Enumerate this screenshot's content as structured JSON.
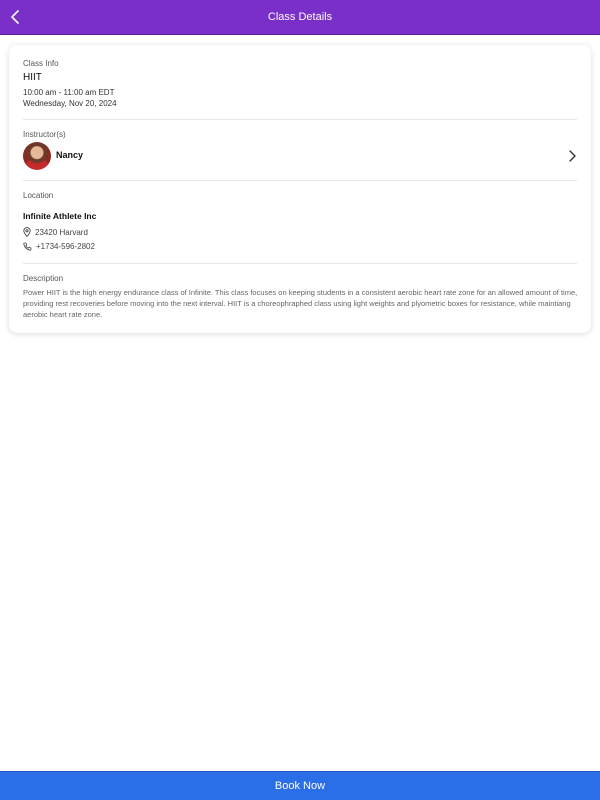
{
  "header": {
    "title": "Class Details",
    "back_icon": "chevron-left-icon",
    "color": "#7b2fc9"
  },
  "class_info": {
    "section_label": "Class Info",
    "name": "HIIT",
    "time": "10:00 am - 11:00 am EDT",
    "date": "Wednesday, Nov 20, 2024"
  },
  "instructors": {
    "section_label": "Instructor(s)",
    "items": [
      {
        "name": "Nancy"
      }
    ]
  },
  "location": {
    "section_label": "Location",
    "name": "Infinite Athlete Inc",
    "address": "23420 Harvard",
    "phone": "+1734-596-2802"
  },
  "description": {
    "section_label": "Description",
    "text": "Power HIIT is the high energy endurance class of Infinite. This class focuses on keeping students in a consistent aerobic heart rate zone for an allowed amount of time, providing rest recoveries before moving into the next interval. HIIT is a choreophraphed class using light weights and plyometric boxes for resistance, while maintiang aerobic heart rate zone."
  },
  "footer": {
    "book_label": "Book Now",
    "color": "#2a6ee8"
  }
}
